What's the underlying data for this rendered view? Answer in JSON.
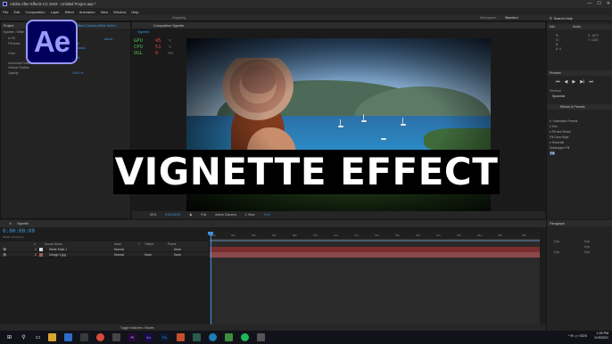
{
  "window": {
    "title": "Adobe After Effects CC 2019 - Untitled Project.aep *",
    "controls": [
      "—",
      "☐",
      "✕"
    ]
  },
  "menu": [
    "File",
    "Edit",
    "Composition",
    "Layer",
    "Effect",
    "Animation",
    "View",
    "Window",
    "Help"
  ],
  "toolbar": {
    "snapping": "Snapping",
    "workspace_label": "Workspace:",
    "workspace_value": "Standard",
    "search_label": "Search Help"
  },
  "logo": {
    "text": "Ae"
  },
  "project_panel": {
    "tab": "Project",
    "effect_controls_tab": "Effect Controls White Solid 1",
    "layer_label": "Vignette • White",
    "about": "About...",
    "rows": [
      {
        "key": "fx Fill",
        "value": ""
      },
      {
        "key": "Fill Mask",
        "value": "None"
      },
      {
        "key": "",
        "value": "All Masks"
      },
      {
        "key": "Color",
        "value": ""
      },
      {
        "key": "",
        "value": "Invert"
      },
      {
        "key": "Horizontal Feather",
        "value": ""
      },
      {
        "key": "Vertical Feather",
        "value": ""
      },
      {
        "key": "Opacity",
        "value": "100.0 %"
      }
    ]
  },
  "perf": {
    "rows": [
      {
        "label": "GPU",
        "value": "45",
        "unit": "°C"
      },
      {
        "label": "CPU",
        "value": "51",
        "unit": "°C"
      },
      {
        "label": "OGL",
        "value": "0",
        "unit": "FPS"
      }
    ],
    "extra": [
      "47",
      "12"
    ]
  },
  "composition": {
    "header": "Composition Vignette",
    "tab": "Vignette",
    "footer": {
      "zoom": "50%",
      "timecode": "0:00:00:00",
      "resolution": "Full",
      "camera": "Active Camera",
      "view": "1 View",
      "exposure": "+0.0"
    }
  },
  "overlay": {
    "title": "VIGNETTE EFFECT"
  },
  "right_panel": {
    "info_tab": "Info",
    "audio_tab": "Audio",
    "info_rows": [
      "R:",
      "G:",
      "B:",
      "A: 0"
    ],
    "coords": [
      "X: 1672",
      "Y: 1302"
    ],
    "preview_tab": "Preview",
    "shortcut_label": "Shortcut",
    "shortcut_value": "Spacebar",
    "effects_tab": "Effects & Presets",
    "tree": [
      "▾ * Animation Presets",
      "  ▾ Text",
      "    ▾ Fill and Stroke",
      "        Fill Color Wipe",
      "▾ Generate",
      "      Eyedropper Fill",
      "      Fill"
    ],
    "selected_index": 6
  },
  "timeline": {
    "tab": "Vignette",
    "timecode": "0:00:00:00",
    "subcode": "00000 (30.00 fps)",
    "columns": [
      "#",
      "Source Name",
      "Mode",
      "T",
      "TrkMat",
      "Parent"
    ],
    "layers": [
      {
        "num": "1",
        "name": "White Solid 1",
        "mode": "Normal",
        "trkmat": "",
        "parent": "None",
        "color": "#d9d9d9"
      },
      {
        "num": "2",
        "name": "Design 1.jpg",
        "mode": "Normal",
        "trkmat": "None",
        "parent": "None",
        "color": "#a35b5b"
      }
    ],
    "ruler": [
      "00s",
      "02s",
      "04s",
      "06s",
      "08s",
      "10s",
      "12s",
      "14s",
      "16s",
      "18s",
      "20s",
      "22s",
      "24s",
      "26s",
      "28s",
      "30s"
    ],
    "footer": "Toggle Switches / Modes"
  },
  "paragraph": {
    "tab": "Paragraph",
    "values": [
      "0 px",
      "0 px",
      "0 px",
      "0 px",
      "0 px"
    ]
  },
  "taskbar": {
    "time": "1:09 PM",
    "date": "1/19/2021",
    "tray": "^ ✉ ◁ ⌁ BOS"
  }
}
